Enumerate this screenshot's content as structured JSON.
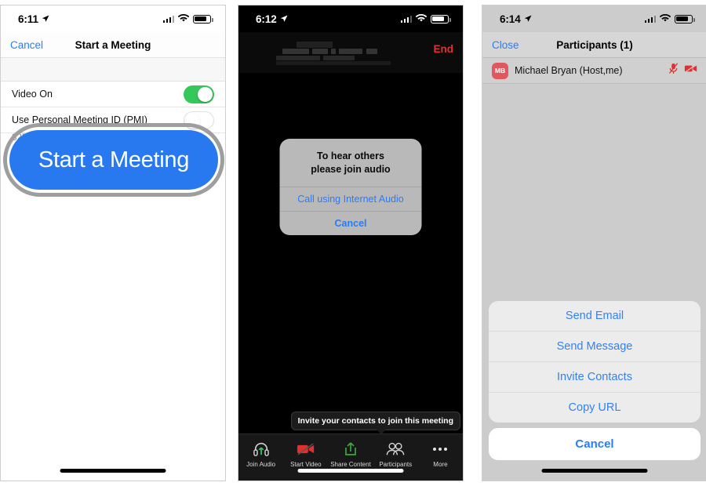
{
  "phone1": {
    "status": {
      "time": "6:11",
      "location_icon": "location-arrow-icon",
      "signal_icon": "cellular-signal-icon",
      "wifi_icon": "wifi-icon",
      "battery_icon": "battery-icon"
    },
    "nav": {
      "left_label": "Cancel",
      "title": "Start a Meeting"
    },
    "rows": [
      {
        "label": "Video On",
        "toggle": "on"
      },
      {
        "label": "Use Personal Meeting ID (PMI)",
        "sub": "825-",
        "toggle": "off"
      }
    ],
    "cta": {
      "label": "Start a Meeting",
      "color": "#2878ef",
      "highlight_ring_color": "#9e9e9e"
    }
  },
  "phone2": {
    "status": {
      "time": "6:12",
      "location_icon": "location-arrow-icon",
      "signal_icon": "cellular-signal-icon",
      "wifi_icon": "wifi-icon",
      "battery_icon": "battery-icon"
    },
    "header": {
      "meeting_id_redacted": true,
      "end_label": "End",
      "end_color": "#e03030"
    },
    "alert": {
      "message_line1": "To hear others",
      "message_line2": "please join audio",
      "primary_label": "Call using Internet Audio",
      "cancel_label": "Cancel"
    },
    "tooltip": "Invite your contacts to join this meeting",
    "toolbar": [
      {
        "label": "Join Audio",
        "icon": "headset-icon",
        "color": "#34c759"
      },
      {
        "label": "Start Video",
        "icon": "camera-off-icon",
        "color": "#e03030"
      },
      {
        "label": "Share Content",
        "icon": "share-upload-icon",
        "color": "#3aa83a"
      },
      {
        "label": "Participants",
        "icon": "people-icon",
        "color": "#d8d8d8"
      },
      {
        "label": "More",
        "icon": "ellipsis-icon",
        "color": "#e2e2e2"
      }
    ]
  },
  "phone3": {
    "status": {
      "time": "6:14",
      "location_icon": "location-arrow-icon",
      "signal_icon": "cellular-signal-icon",
      "wifi_icon": "wifi-icon",
      "battery_icon": "battery-icon"
    },
    "nav": {
      "left_label": "Close",
      "title": "Participants (1)"
    },
    "participant": {
      "initials": "MB",
      "avatar_color": "#e2575f",
      "name": "Michael Bryan (Host,me)",
      "mic_icon": "microphone-muted-icon",
      "video_icon": "camera-off-icon",
      "icon_color": "#e03030"
    },
    "action_sheet": {
      "items": [
        "Send Email",
        "Send Message",
        "Invite Contacts",
        "Copy URL"
      ],
      "cancel_label": "Cancel"
    }
  }
}
